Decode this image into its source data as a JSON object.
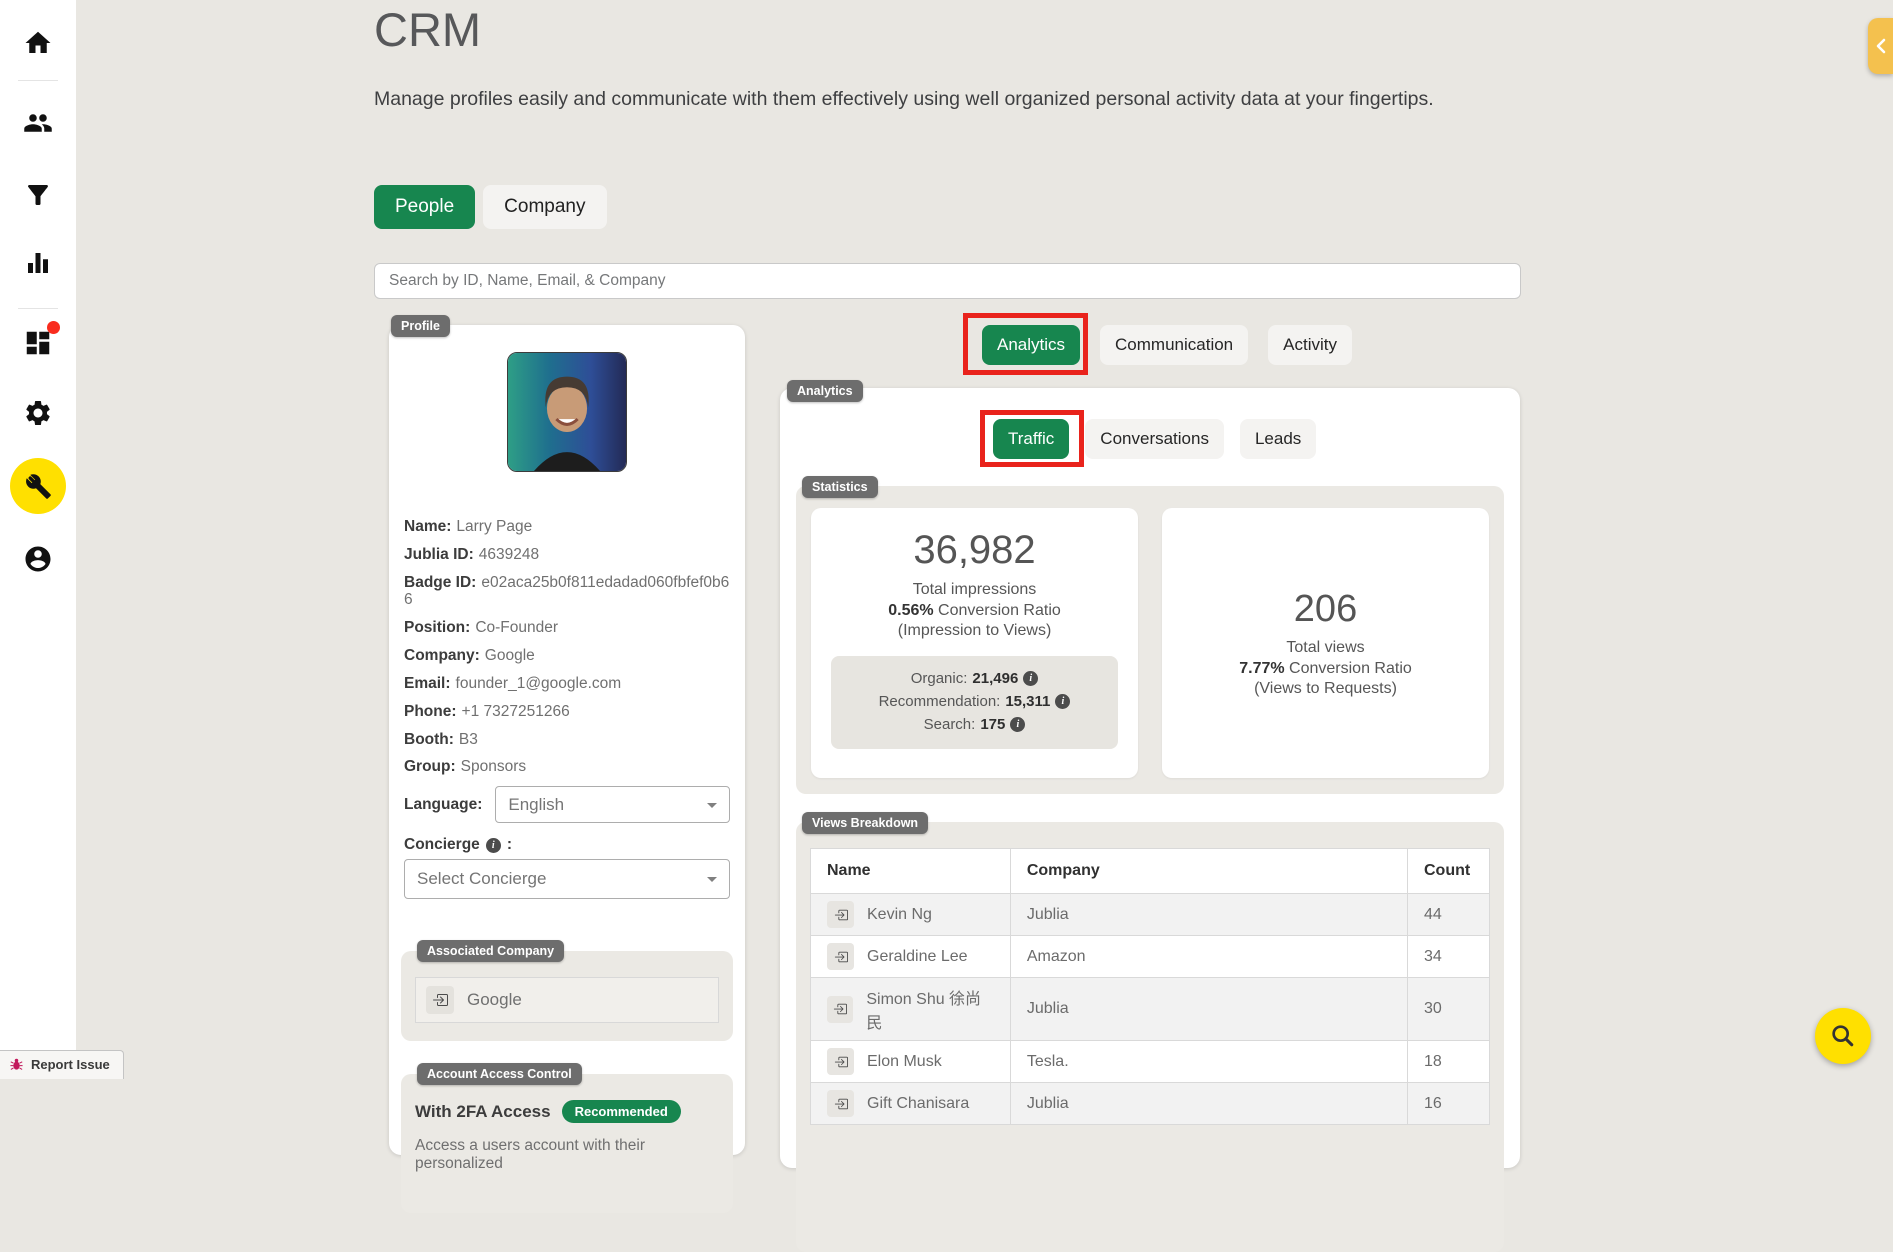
{
  "page": {
    "title": "CRM",
    "subtitle": "Manage profiles easily and communicate with them effectively using well organized personal activity data at your fingertips."
  },
  "sidebar": {
    "icons": [
      "home",
      "people",
      "filter",
      "bar-chart",
      "dashboard",
      "settings",
      "tools",
      "account"
    ],
    "active_icon": "tools",
    "has_notification_dot": true
  },
  "entity_toggle": {
    "options": [
      "People",
      "Company"
    ],
    "active": "People"
  },
  "search": {
    "placeholder": "Search by ID, Name, Email, & Company"
  },
  "profile": {
    "badge": "Profile",
    "fields": [
      {
        "label": "Name:",
        "value": "Larry Page"
      },
      {
        "label": "Jublia ID:",
        "value": "4639248"
      },
      {
        "label": "Badge ID:",
        "value": "e02aca25b0f811edadad060fbfef0b66"
      },
      {
        "label": "Position:",
        "value": "Co-Founder"
      },
      {
        "label": "Company:",
        "value": "Google"
      },
      {
        "label": "Email:",
        "value": "founder_1@google.com"
      },
      {
        "label": "Phone:",
        "value": "+1 7327251266"
      },
      {
        "label": "Booth:",
        "value": "B3"
      },
      {
        "label": "Group:",
        "value": "Sponsors"
      }
    ],
    "language": {
      "label": "Language:",
      "value": "English"
    },
    "concierge": {
      "label": "Concierge",
      "colon": ":",
      "placeholder": "Select Concierge"
    },
    "associated_company": {
      "badge": "Associated Company",
      "items": [
        "Google"
      ]
    },
    "account_access": {
      "badge": "Account Access Control",
      "heading": "With 2FA Access",
      "tag": "Recommended",
      "description": "Access a users account with their personalized"
    }
  },
  "tabs": {
    "items": [
      "Analytics",
      "Communication",
      "Activity"
    ],
    "active": "Analytics"
  },
  "analytics": {
    "badge": "Analytics",
    "sub_tabs": {
      "items": [
        "Traffic",
        "Conversations",
        "Leads"
      ],
      "active": "Traffic"
    },
    "statistics": {
      "badge": "Statistics",
      "impressions": {
        "value": "36,982",
        "label": "Total impressions",
        "ratio_value": "0.56%",
        "ratio_text": "Conversion Ratio",
        "ratio_note": "(Impression to Views)",
        "breakdown": [
          {
            "label": "Organic:",
            "value": "21,496"
          },
          {
            "label": "Recommendation:",
            "value": "15,311"
          },
          {
            "label": "Search:",
            "value": "175"
          }
        ]
      },
      "views": {
        "value": "206",
        "label": "Total views",
        "ratio_value": "7.77%",
        "ratio_text": "Conversion Ratio",
        "ratio_note": "(Views to Requests)"
      }
    },
    "views_breakdown": {
      "badge": "Views Breakdown",
      "columns": [
        "Name",
        "Company",
        "Count"
      ],
      "rows": [
        {
          "name": "Kevin Ng",
          "company": "Jublia",
          "count": "44"
        },
        {
          "name": "Geraldine Lee",
          "company": "Amazon",
          "count": "34"
        },
        {
          "name": "Simon Shu 徐尚民",
          "company": "Jublia",
          "count": "30"
        },
        {
          "name": "Elon Musk",
          "company": "Tesla.",
          "count": "18"
        },
        {
          "name": "Gift Chanisara",
          "company": "Jublia",
          "count": "16"
        }
      ]
    }
  },
  "report_issue": {
    "label": "Report Issue"
  },
  "colors": {
    "accent_green": "#17864f",
    "annotation_red": "#e9231c",
    "fab_yellow": "#ffe000",
    "edge_tab_amber": "#f4c14e",
    "badge_gray": "#6d6d6d",
    "notification_red": "#f92c1e",
    "page_background": "#e9e7e2"
  }
}
